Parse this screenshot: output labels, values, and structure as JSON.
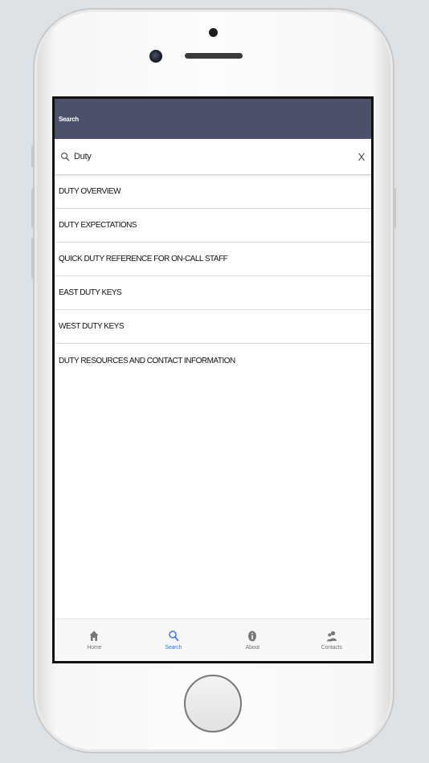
{
  "header": {
    "title": "Search"
  },
  "search": {
    "value": "Duty",
    "clear_label": "X"
  },
  "results": [
    {
      "label": "DUTY OVERVIEW"
    },
    {
      "label": "DUTY EXPECTATIONS"
    },
    {
      "label": "QUICK DUTY REFERENCE FOR ON-CALL STAFF"
    },
    {
      "label": "EAST DUTY KEYS"
    },
    {
      "label": "WEST DUTY KEYS"
    },
    {
      "label": "DUTY RESOURCES AND CONTACT INFORMATION"
    }
  ],
  "tabs": [
    {
      "label": "Home",
      "icon": "home-icon",
      "active": false
    },
    {
      "label": "Search",
      "icon": "search-icon",
      "active": true
    },
    {
      "label": "About",
      "icon": "info-icon",
      "active": false
    },
    {
      "label": "Contacts",
      "icon": "contacts-icon",
      "active": false
    }
  ],
  "colors": {
    "header_bg": "#4b5168",
    "active_tab": "#3478f6",
    "inactive_tab": "#777777",
    "background": "#dce2e6"
  }
}
